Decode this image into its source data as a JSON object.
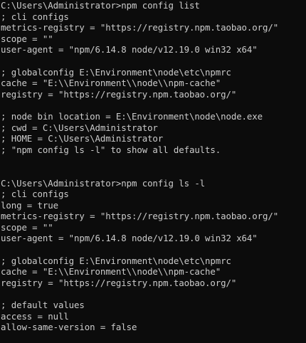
{
  "terminal": {
    "lines": [
      "C:\\Users\\Administrator>npm config list",
      "; cli configs",
      "metrics-registry = \"https://registry.npm.taobao.org/\"",
      "scope = \"\"",
      "user-agent = \"npm/6.14.8 node/v12.19.0 win32 x64\"",
      "",
      "; globalconfig E:\\Environment\\node\\etc\\npmrc",
      "cache = \"E:\\\\Environment\\\\node\\\\npm-cache\"",
      "registry = \"https://registry.npm.taobao.org/\"",
      "",
      "; node bin location = E:\\Environment\\node\\node.exe",
      "; cwd = C:\\Users\\Administrator",
      "; HOME = C:\\Users\\Administrator",
      "; \"npm config ls -l\" to show all defaults.",
      "",
      "",
      "C:\\Users\\Administrator>npm config ls -l",
      "; cli configs",
      "long = true",
      "metrics-registry = \"https://registry.npm.taobao.org/\"",
      "scope = \"\"",
      "user-agent = \"npm/6.14.8 node/v12.19.0 win32 x64\"",
      "",
      "; globalconfig E:\\Environment\\node\\etc\\npmrc",
      "cache = \"E:\\\\Environment\\\\node\\\\npm-cache\"",
      "registry = \"https://registry.npm.taobao.org/\"",
      "",
      "; default values",
      "access = null",
      "allow-same-version = false"
    ]
  }
}
